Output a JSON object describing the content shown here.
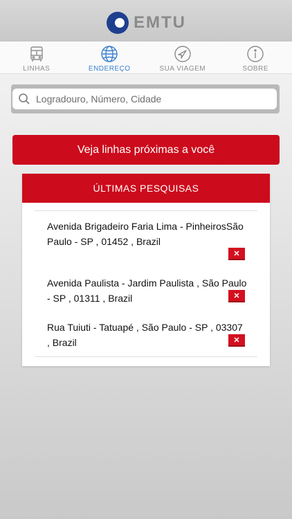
{
  "header": {
    "logo_text": "EMTU"
  },
  "tabs": [
    {
      "label": "LINHAS",
      "icon": "bus-icon"
    },
    {
      "label": "ENDEREÇO",
      "icon": "globe-icon"
    },
    {
      "label": "SUA VIAGEM",
      "icon": "navigation-arrow-icon"
    },
    {
      "label": "SOBRE",
      "icon": "info-icon"
    }
  ],
  "active_tab": "ENDEREÇO",
  "search": {
    "placeholder": "Logradouro, Número, Cidade",
    "value": ""
  },
  "nearby_button": {
    "label": "Veja linhas próximas a você"
  },
  "recent": {
    "title": "ÚLTIMAS PESQUISAS",
    "items": [
      {
        "address": "Avenida Brigadeiro Faria Lima - PinheirosSão Paulo - SP , 01452 , Brazil"
      },
      {
        "address": "Avenida Paulista - Jardim Paulista , São Paulo - SP , 01311 , Brazil"
      },
      {
        "address": "Rua Tuiuti - Tatuapé , São Paulo - SP , 03307 , Brazil"
      }
    ],
    "remove_symbol": "✕"
  },
  "colors": {
    "brand_red": "#cc0b1c",
    "active_blue": "#3a7fcf",
    "inactive_gray": "#8c8c8c"
  }
}
